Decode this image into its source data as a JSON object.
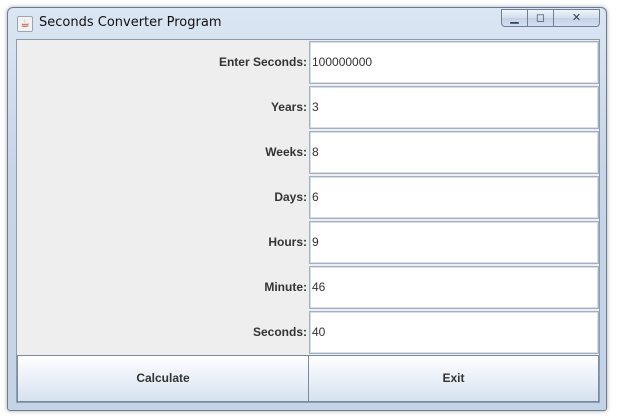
{
  "window": {
    "title": "Seconds Converter Program",
    "app_icon": "java-cup-icon",
    "controls": {
      "minimize": "minimize-icon",
      "maximize": "restore-icon",
      "close": "close-icon"
    }
  },
  "form": {
    "rows": [
      {
        "label": "Enter Seconds:",
        "value": "100000000"
      },
      {
        "label": "Years:",
        "value": "3"
      },
      {
        "label": "Weeks:",
        "value": "8"
      },
      {
        "label": "Days:",
        "value": "6"
      },
      {
        "label": "Hours:",
        "value": "9"
      },
      {
        "label": "Minute:",
        "value": "46"
      },
      {
        "label": "Seconds:",
        "value": "40"
      }
    ]
  },
  "buttons": {
    "calculate": "Calculate",
    "exit": "Exit"
  }
}
